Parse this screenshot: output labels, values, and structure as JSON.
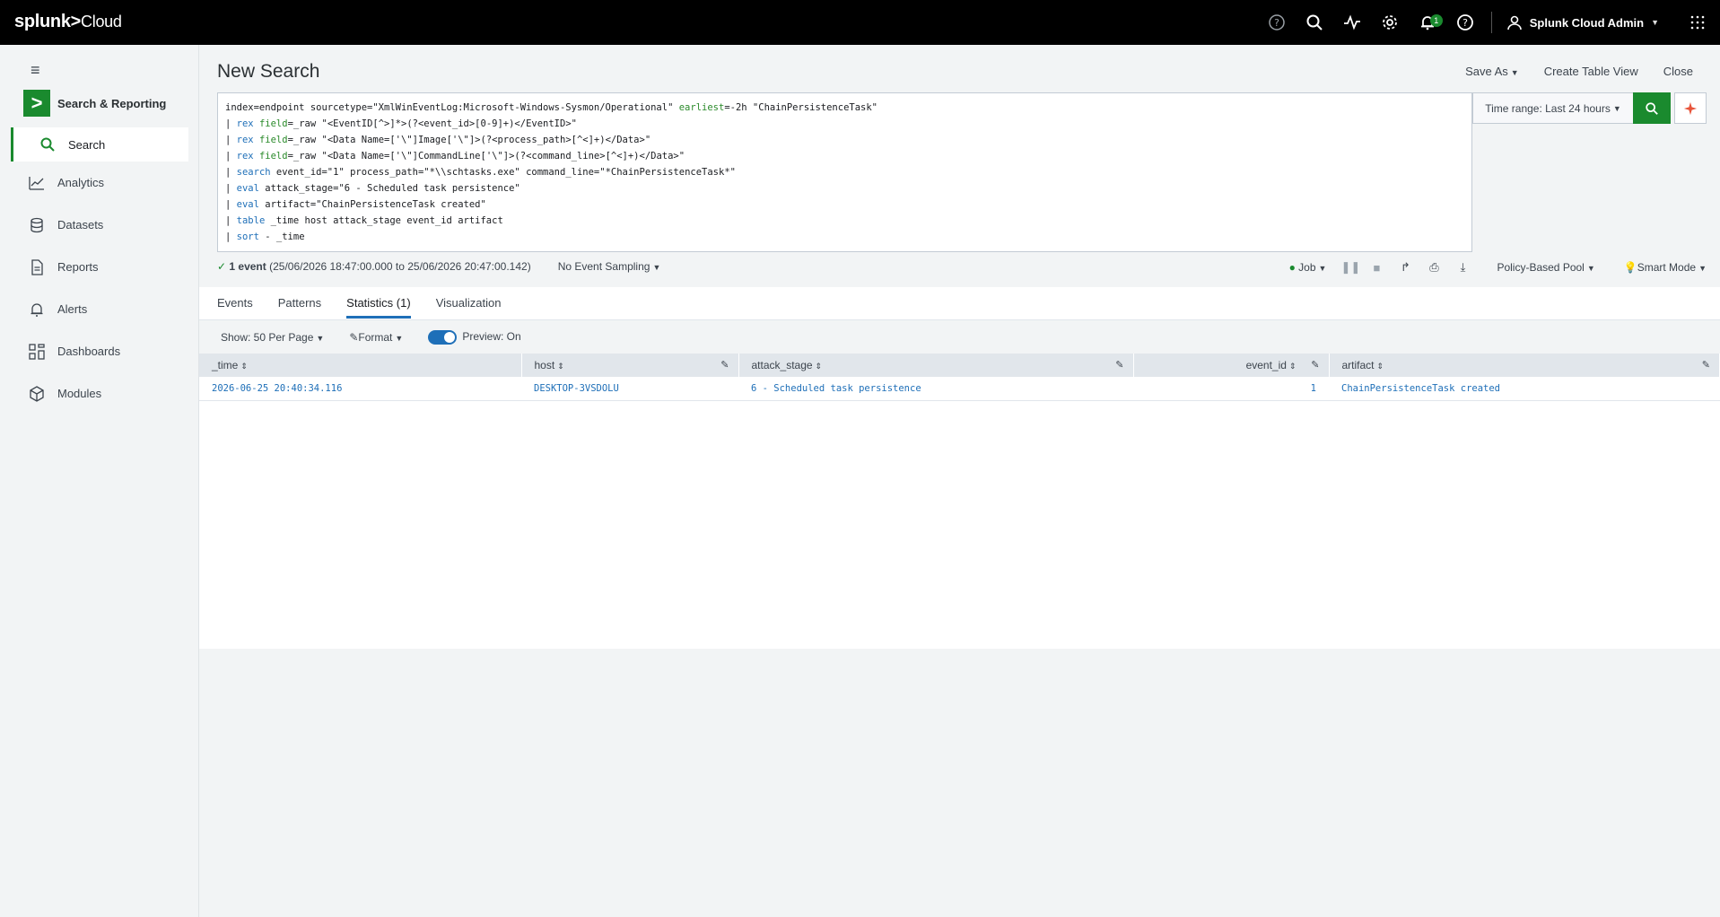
{
  "topbar": {
    "logo_main": "splunk>",
    "logo_suffix": "Cloud",
    "notif_count": "1",
    "user_name": "Splunk Cloud Admin"
  },
  "sidebar": {
    "app_name": "Search & Reporting",
    "items": [
      {
        "label": "Search",
        "icon": "search-icon",
        "active": true
      },
      {
        "label": "Analytics",
        "icon": "analytics-icon"
      },
      {
        "label": "Datasets",
        "icon": "datasets-icon"
      },
      {
        "label": "Reports",
        "icon": "reports-icon"
      },
      {
        "label": "Alerts",
        "icon": "alerts-icon"
      },
      {
        "label": "Dashboards",
        "icon": "dashboards-icon"
      },
      {
        "label": "Modules",
        "icon": "modules-icon"
      }
    ]
  },
  "header": {
    "title": "New Search",
    "save_as": "Save As",
    "create_table_view": "Create Table View",
    "close": "Close"
  },
  "query": {
    "l1_a": "index=endpoint sourcetype=\"XmlWinEventLog:Microsoft-Windows-Sysmon/Operational\" ",
    "l1_kw": "earliest",
    "l1_b": "=-2h \"ChainPersistenceTask\"",
    "l2_kw1": "rex",
    "l2_kw2": "field",
    "l2_b": "=_raw \"<EventID[^>]*>(?<event_id>[0-9]+)</EventID>\"",
    "l3_kw1": "rex",
    "l3_kw2": "field",
    "l3_b": "=_raw \"<Data Name=['\\\"]Image['\\\"]>(?<process_path>[^<]+)</Data>\"",
    "l4_kw1": "rex",
    "l4_kw2": "field",
    "l4_b": "=_raw \"<Data Name=['\\\"]CommandLine['\\\"]>(?<command_line>[^<]+)</Data>\"",
    "l5_kw": "search",
    "l5_b": " event_id=\"1\" process_path=\"*\\\\schtasks.exe\" command_line=\"*ChainPersistenceTask*\"",
    "l6_kw": "eval",
    "l6_b": " attack_stage=\"6 - Scheduled task persistence\"",
    "l7_kw": "eval",
    "l7_b": " artifact=\"ChainPersistenceTask created\"",
    "l8_kw": "table",
    "l8_b": " _time host attack_stage event_id artifact",
    "l9_kw": "sort",
    "l9_b": " - _time",
    "pipe": "| "
  },
  "time_range": "Time range: Last 24 hours",
  "status": {
    "count": "1 event",
    "range": "(25/06/2026 18:47:00.000 to 25/06/2026 20:47:00.142)",
    "sampling": "No Event Sampling",
    "job": "Job",
    "pool": "Policy-Based Pool",
    "mode": "Smart Mode"
  },
  "tabs": [
    "Events",
    "Patterns",
    "Statistics (1)",
    "Visualization"
  ],
  "toolbar": {
    "show": "Show: 50 Per Page",
    "format": "Format",
    "preview": "Preview: On"
  },
  "table": {
    "columns": [
      "_time",
      "host",
      "attack_stage",
      "event_id",
      "artifact"
    ],
    "rows": [
      [
        "2026-06-25 20:40:34.116",
        "DESKTOP-3VSDOLU",
        "6 - Scheduled task persistence",
        "1",
        "ChainPersistenceTask created"
      ]
    ]
  },
  "colors": {
    "brand_green": "#1a8a2e",
    "link_blue": "#1e6fb8"
  }
}
